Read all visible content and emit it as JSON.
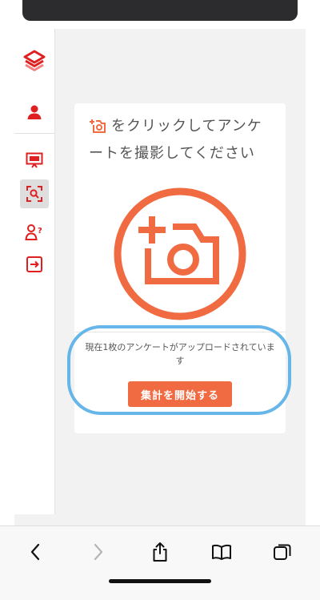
{
  "card": {
    "title": "をクリックしてアンケートを撮影してください",
    "status": "現在1枚のアンケートがアップロードされています",
    "start_button": "集計を開始する"
  },
  "sidebar": {
    "items": [
      {
        "icon": "logo-icon"
      },
      {
        "icon": "user-icon"
      },
      {
        "icon": "presentation-icon"
      },
      {
        "icon": "scan-icon",
        "active": true
      },
      {
        "icon": "user-question-icon"
      },
      {
        "icon": "logout-icon"
      }
    ]
  },
  "toolbar": {
    "items": [
      "back-icon",
      "forward-icon",
      "share-icon",
      "bookmarks-icon",
      "tabs-icon"
    ]
  },
  "colors": {
    "accent": "#f06b42",
    "sidebar_icon": "#e02020",
    "highlight": "#56aee8"
  }
}
